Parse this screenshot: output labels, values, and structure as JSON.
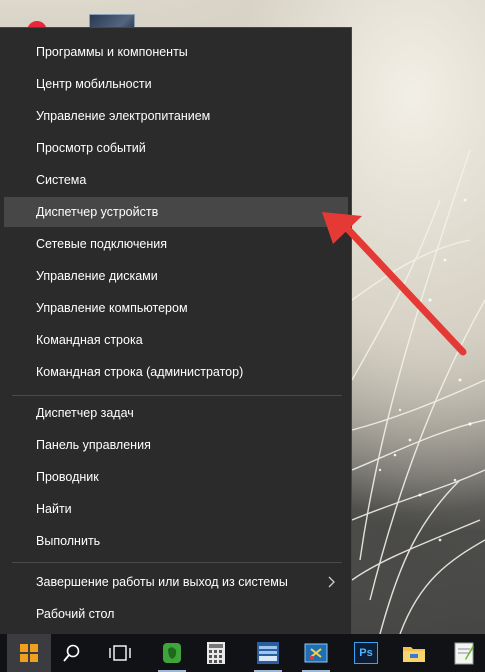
{
  "menu": {
    "groups": [
      [
        "Программы и компоненты",
        "Центр мобильности",
        "Управление электропитанием",
        "Просмотр событий",
        "Система",
        "Диспетчер устройств",
        "Сетевые подключения",
        "Управление дисками",
        "Управление компьютером",
        "Командная строка",
        "Командная строка (администратор)"
      ],
      [
        "Диспетчер задач",
        "Панель управления",
        "Проводник",
        "Найти",
        "Выполнить"
      ],
      [
        "Завершение работы или выход из системы",
        "Рабочий стол"
      ]
    ],
    "highlighted": "Диспетчер устройств",
    "submenu_item": "Завершение работы или выход из системы"
  },
  "colors": {
    "menu_bg": "#2b2b2b",
    "highlight_bg": "#474747",
    "annotation_arrow": "#e53935",
    "taskbar_bg": "#101216"
  },
  "taskbar": {
    "icons": [
      "windows-start-icon",
      "search-icon",
      "task-view-icon",
      "evernote-icon",
      "calculator-icon",
      "text-editor-icon",
      "screenshot-tool-icon",
      "photoshop-icon",
      "file-explorer-icon",
      "notepad-icon"
    ],
    "photoshop_label": "Ps"
  }
}
